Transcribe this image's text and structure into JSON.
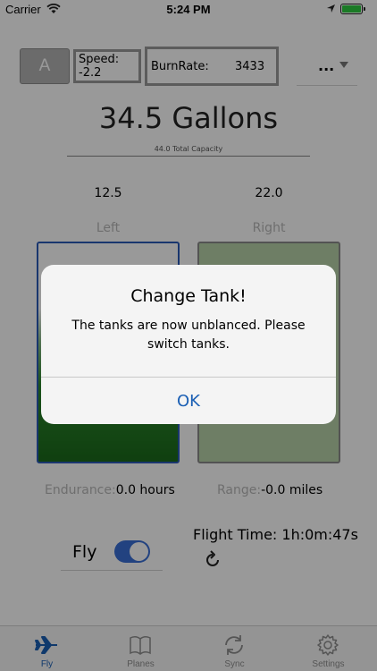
{
  "status_bar": {
    "carrier": "Carrier",
    "time": "5:24 PM"
  },
  "header": {
    "mode_label": "A",
    "speed_text": "Speed: -2.2",
    "burn_rate_label": "BurnRate:",
    "burn_rate_value": "3433",
    "more_label": "..."
  },
  "fuel": {
    "gallons_text": "34.5 Gallons",
    "capacity_text": "44.0 Total Capacity"
  },
  "tanks": {
    "left": {
      "value": "12.5",
      "label": "Left",
      "fill_fraction": 0.65
    },
    "right": {
      "value": "22.0",
      "label": "Right",
      "fill_fraction": 1.0
    }
  },
  "stats": {
    "endurance_label": "Endurance:",
    "endurance_value": "0.0 hours",
    "range_label": "Range:",
    "range_value": "-0.0 miles"
  },
  "controls": {
    "fly_label": "Fly",
    "fly_enabled": true,
    "flight_time_text": "Flight Time: 1h:0m:47s"
  },
  "tab_bar": {
    "tabs": [
      {
        "label": "Fly",
        "icon": "airplane-icon",
        "active": true
      },
      {
        "label": "Planes",
        "icon": "book-icon",
        "active": false
      },
      {
        "label": "Sync",
        "icon": "sync-icon",
        "active": false
      },
      {
        "label": "Settings",
        "icon": "gear-icon",
        "active": false
      }
    ]
  },
  "alert": {
    "title": "Change Tank!",
    "message": "The tanks are now unblanced. Please switch tanks.",
    "ok_label": "OK"
  },
  "colors": {
    "accent": "#1a5fb4",
    "tank_left_border": "#2a5ab8",
    "tank_fill_green": "#1a6a1a",
    "tank_right_fill": "#b7d3a8"
  }
}
